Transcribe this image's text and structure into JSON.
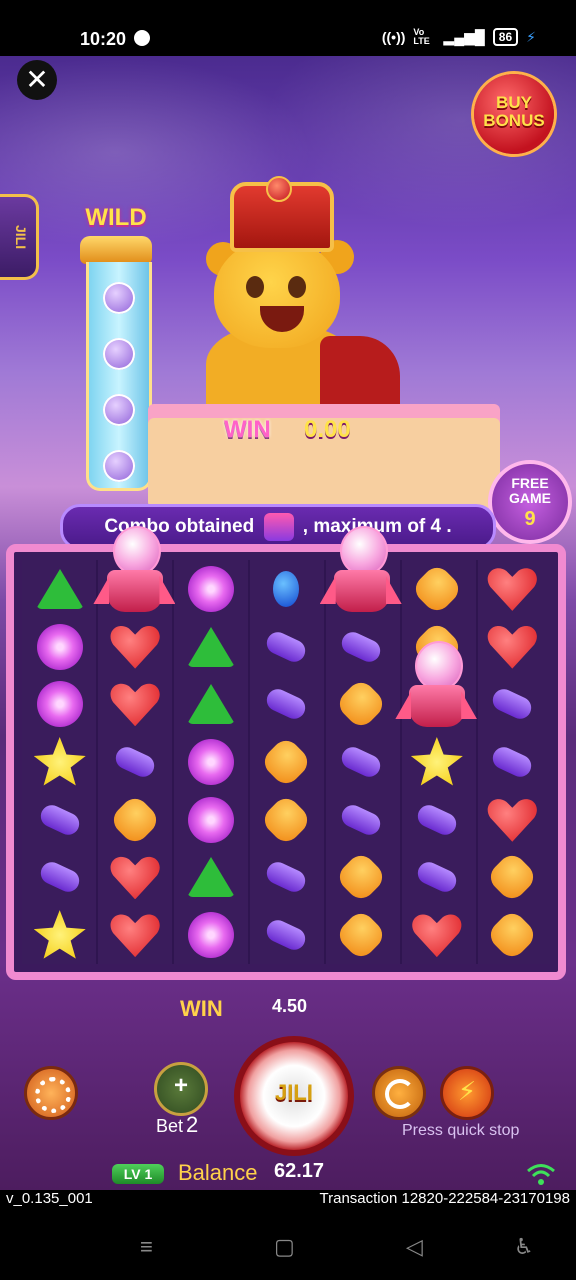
{
  "status": {
    "time": "10:20",
    "network": "Vo LTE",
    "battery": "86"
  },
  "game": {
    "buy_bonus": "BUY BONUS",
    "side_tab": "JILI",
    "wild_label": "WILD",
    "banner_win_label": "WIN",
    "banner_win_value": "0.00",
    "free_game_label": "FREE GAME",
    "free_game_count": "9",
    "message_left": "Combo obtained",
    "message_right": ", maximum of 4 .",
    "win_label": "WIN",
    "win_amount": "4.50",
    "bet_label": "Bet",
    "bet_value": "2",
    "spin_label": "JILI",
    "quick_stop": "Press quick stop",
    "level": "LV 1",
    "balance_label": "Balance",
    "balance_value": "62.17"
  },
  "grid": [
    [
      "green",
      "gumball",
      "pink",
      "blue",
      "gumball",
      "orange",
      "red"
    ],
    [
      "pink",
      "red",
      "green",
      "purple",
      "purple",
      "orange",
      "red"
    ],
    [
      "pink",
      "red",
      "green",
      "purple",
      "orange",
      "gumball",
      "purple"
    ],
    [
      "yellow",
      "purple",
      "pink",
      "orange",
      "purple",
      "yellow",
      "purple"
    ],
    [
      "purple",
      "orange",
      "pink",
      "orange",
      "purple",
      "purple",
      "red"
    ],
    [
      "purple",
      "red",
      "green",
      "purple",
      "orange",
      "purple",
      "orange"
    ],
    [
      "yellow",
      "red",
      "pink",
      "purple",
      "orange",
      "red",
      "orange"
    ]
  ],
  "footer": {
    "version": "v_0.135_001",
    "transaction": "Transaction 12820-222584-23170198"
  }
}
